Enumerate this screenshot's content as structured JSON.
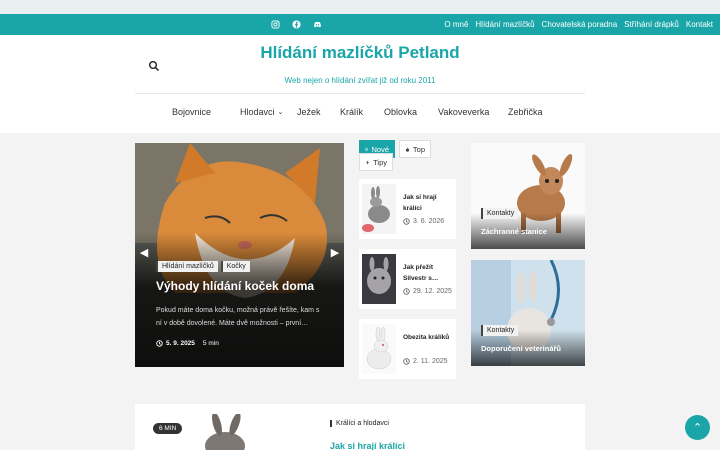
{
  "topbar": {
    "social_icons": [
      "instagram-icon",
      "facebook-icon",
      "discord-icon"
    ],
    "links": [
      "O mně",
      "Hlídání mazlíčků",
      "Chovatelská poradna",
      "Stříhání drápků",
      "Kontakt"
    ]
  },
  "header": {
    "site_title": "Hlídání mazlíčků Petland",
    "tagline": "Web nejen o hlídání zvířat již od roku 2011"
  },
  "main_nav": [
    "Bojovnice",
    "Hlodavci",
    "Ježek",
    "Králík",
    "Oblovka",
    "Vakoveverka",
    "Zebřička"
  ],
  "featured": {
    "tags": [
      "Hlídání mazlíčků",
      "Kočky"
    ],
    "title": "Výhody hlídání koček doma",
    "excerpt": "Pokud máte doma kočku, možná právě řešíte, kam s ní v době dovolené. Máte dvě možnosti – první…",
    "date": "5. 9. 2025",
    "read_time": "5 min"
  },
  "tabs": [
    "Nové",
    "Top",
    "Tipy"
  ],
  "posts": [
    {
      "title": "Jak si hrají králíci",
      "date": "3. 6. 2026"
    },
    {
      "title": "Jak přežít Silvestr s…",
      "date": "29. 12. 2025"
    },
    {
      "title": "Obezita králíků",
      "date": "2. 11. 2025"
    }
  ],
  "side_cards": [
    {
      "tag": "Kontakty",
      "title": "Záchranné stanice"
    },
    {
      "tag": "Kontakty",
      "title": "Doporučení veterinářů"
    }
  ],
  "bottom_card": {
    "read_time": "6 MIN",
    "category": "Králíci a hlodavci",
    "title": "Jak si hrají králíci"
  },
  "colors": {
    "accent": "#1aa6a8"
  }
}
